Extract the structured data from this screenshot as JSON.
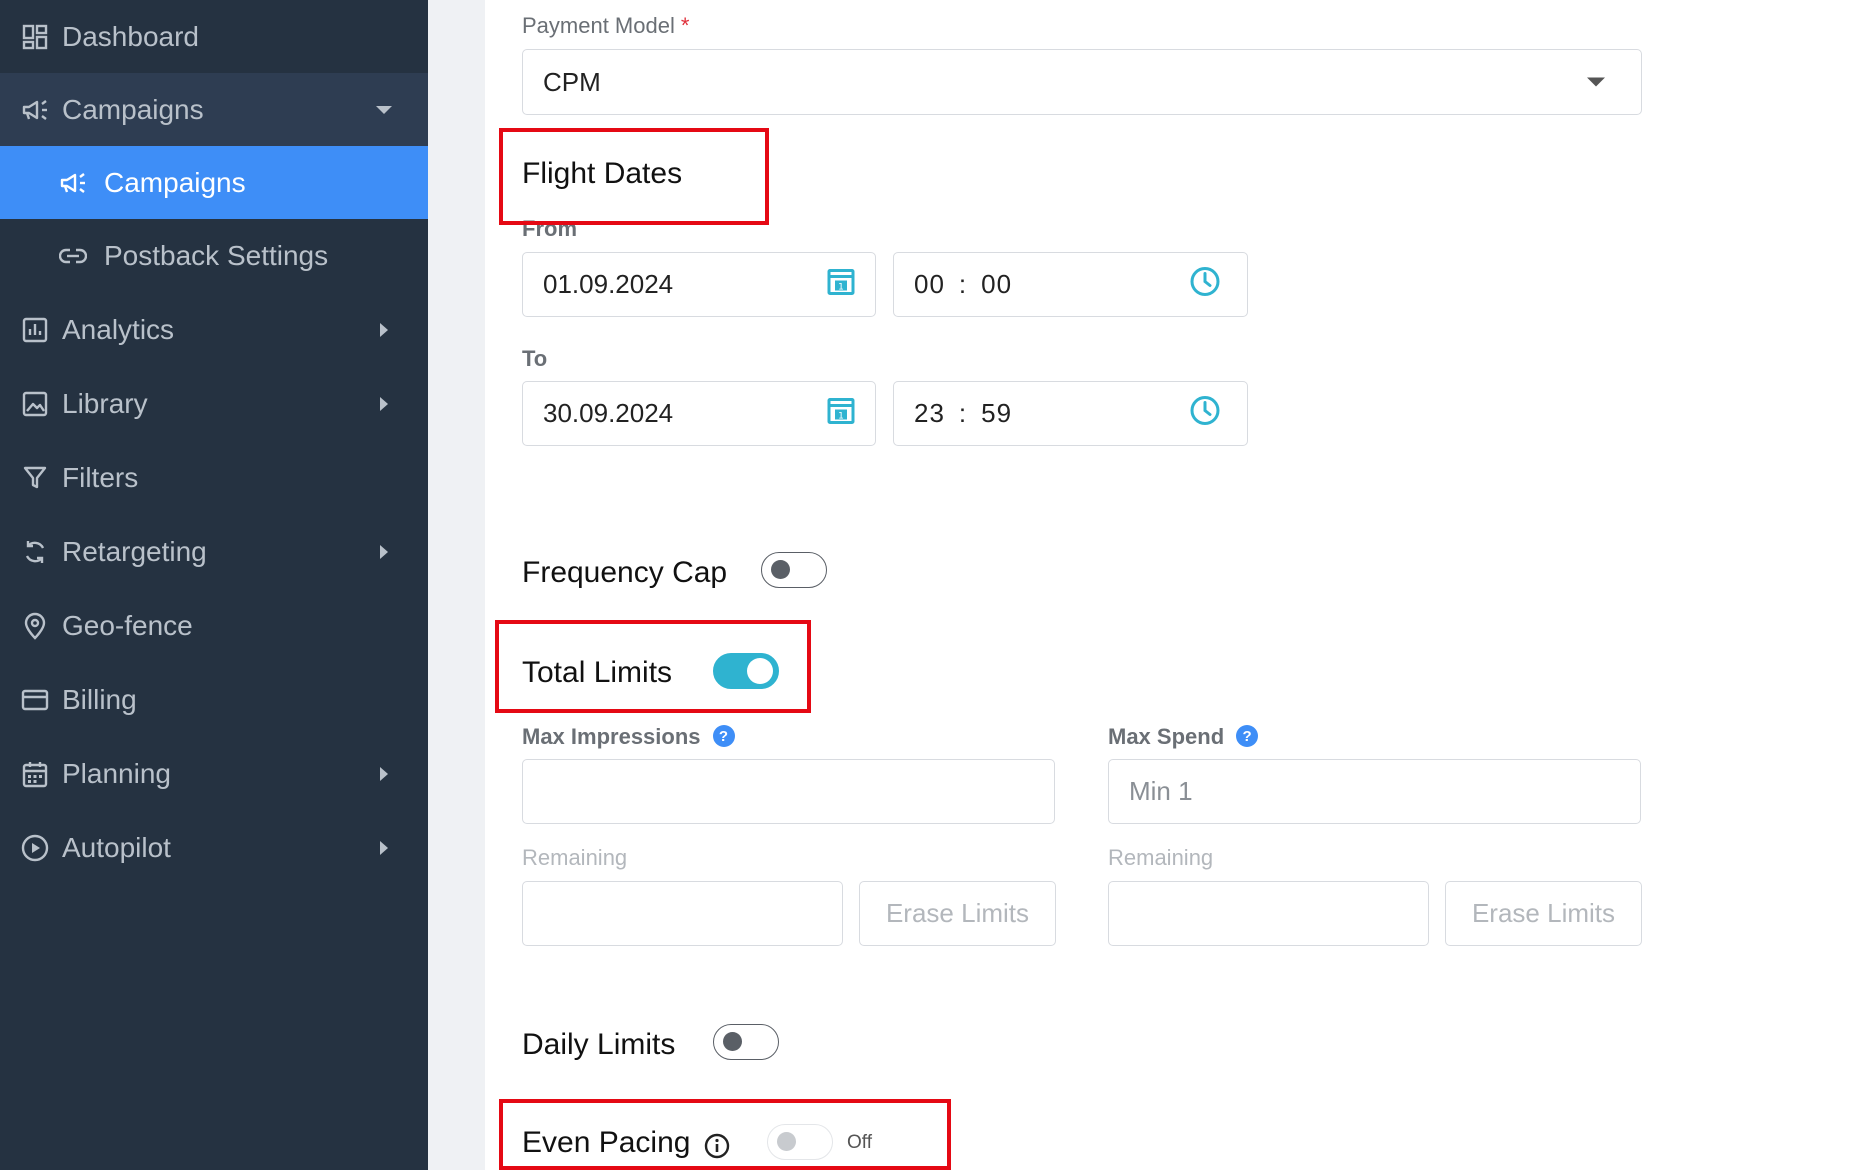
{
  "sidebar": {
    "items": [
      {
        "label": "Dashboard",
        "icon": "dashboard-icon"
      },
      {
        "label": "Campaigns",
        "icon": "megaphone-icon"
      },
      {
        "label": "Campaigns",
        "icon": "megaphone-icon"
      },
      {
        "label": "Postback Settings",
        "icon": "link-icon"
      },
      {
        "label": "Analytics",
        "icon": "chart-icon"
      },
      {
        "label": "Library",
        "icon": "image-icon"
      },
      {
        "label": "Filters",
        "icon": "filter-icon"
      },
      {
        "label": "Retargeting",
        "icon": "refresh-icon"
      },
      {
        "label": "Geo-fence",
        "icon": "map-pin-icon"
      },
      {
        "label": "Billing",
        "icon": "credit-card-icon"
      },
      {
        "label": "Planning",
        "icon": "calendar-icon"
      },
      {
        "label": "Autopilot",
        "icon": "play-circle-icon"
      }
    ],
    "active_color": "#3e8ef7",
    "background": "#253241"
  },
  "payment_model": {
    "label": "Payment Model",
    "required_mark": "*",
    "value": "CPM"
  },
  "flight_dates": {
    "title": "Flight Dates",
    "from_label": "From",
    "from_date": "01.09.2024",
    "from_hour": "00",
    "from_minute": "00",
    "to_label": "To",
    "to_date": "30.09.2024",
    "to_hour": "23",
    "to_minute": "59",
    "time_separator": ":"
  },
  "frequency_cap": {
    "label": "Frequency Cap",
    "enabled": false
  },
  "total_limits": {
    "label": "Total Limits",
    "enabled": true,
    "max_impressions_label": "Max Impressions",
    "max_impressions_value": "",
    "max_spend_label": "Max Spend",
    "max_spend_placeholder": "Min 1",
    "remaining_label": "Remaining",
    "erase_label": "Erase Limits"
  },
  "daily_limits": {
    "label": "Daily Limits",
    "enabled": false
  },
  "even_pacing": {
    "label": "Even Pacing",
    "enabled": false,
    "state_text": "Off"
  },
  "colors": {
    "highlight": "#e50914",
    "toggle_on": "#2fb3d0",
    "help_icon": "#3e8ef7"
  }
}
